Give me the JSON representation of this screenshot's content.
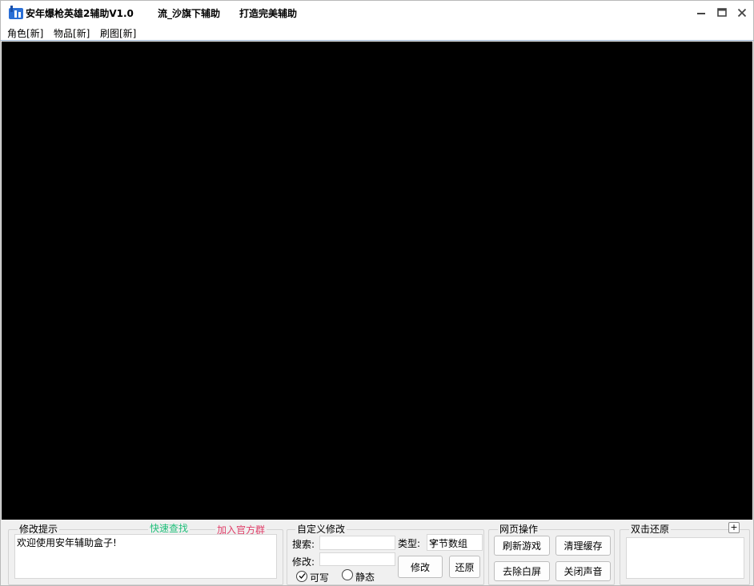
{
  "window": {
    "title": "安年爆枪英雄2辅助V1.0",
    "title_links": [
      "流_沙旗下辅助",
      "打造完美辅助"
    ],
    "controls": {
      "minimize": "minimize-icon",
      "maximize": "maximize-icon",
      "close": "close-icon"
    }
  },
  "menu": [
    "角色[新]",
    "物品[新]",
    "刷图[新]"
  ],
  "tips_panel": {
    "title": "修改提示",
    "quick_find": "快速查找",
    "join_group": "加入官方群",
    "message": "欢迎使用安年辅助盒子!"
  },
  "custom_panel": {
    "title": "自定义修改",
    "search_label": "搜索:",
    "search_value": "",
    "modify_label": "修改:",
    "modify_value": "",
    "type_label": "类型:",
    "type_value": "字节数组",
    "modify_button": "修改",
    "restore_button": "还原",
    "writable_label": "可写",
    "static_label": "静态"
  },
  "web_panel": {
    "title": "网页操作",
    "buttons": [
      "刷新游戏",
      "清理缓存",
      "去除白屏",
      "关闭声音"
    ]
  },
  "restore_panel": {
    "title": "双击还原",
    "add_label": "+"
  },
  "colors": {
    "quick_find": "#1fbf7a",
    "join_group": "#e0406a",
    "viewport": "#000000",
    "menu_border": "#9fb6d2"
  }
}
